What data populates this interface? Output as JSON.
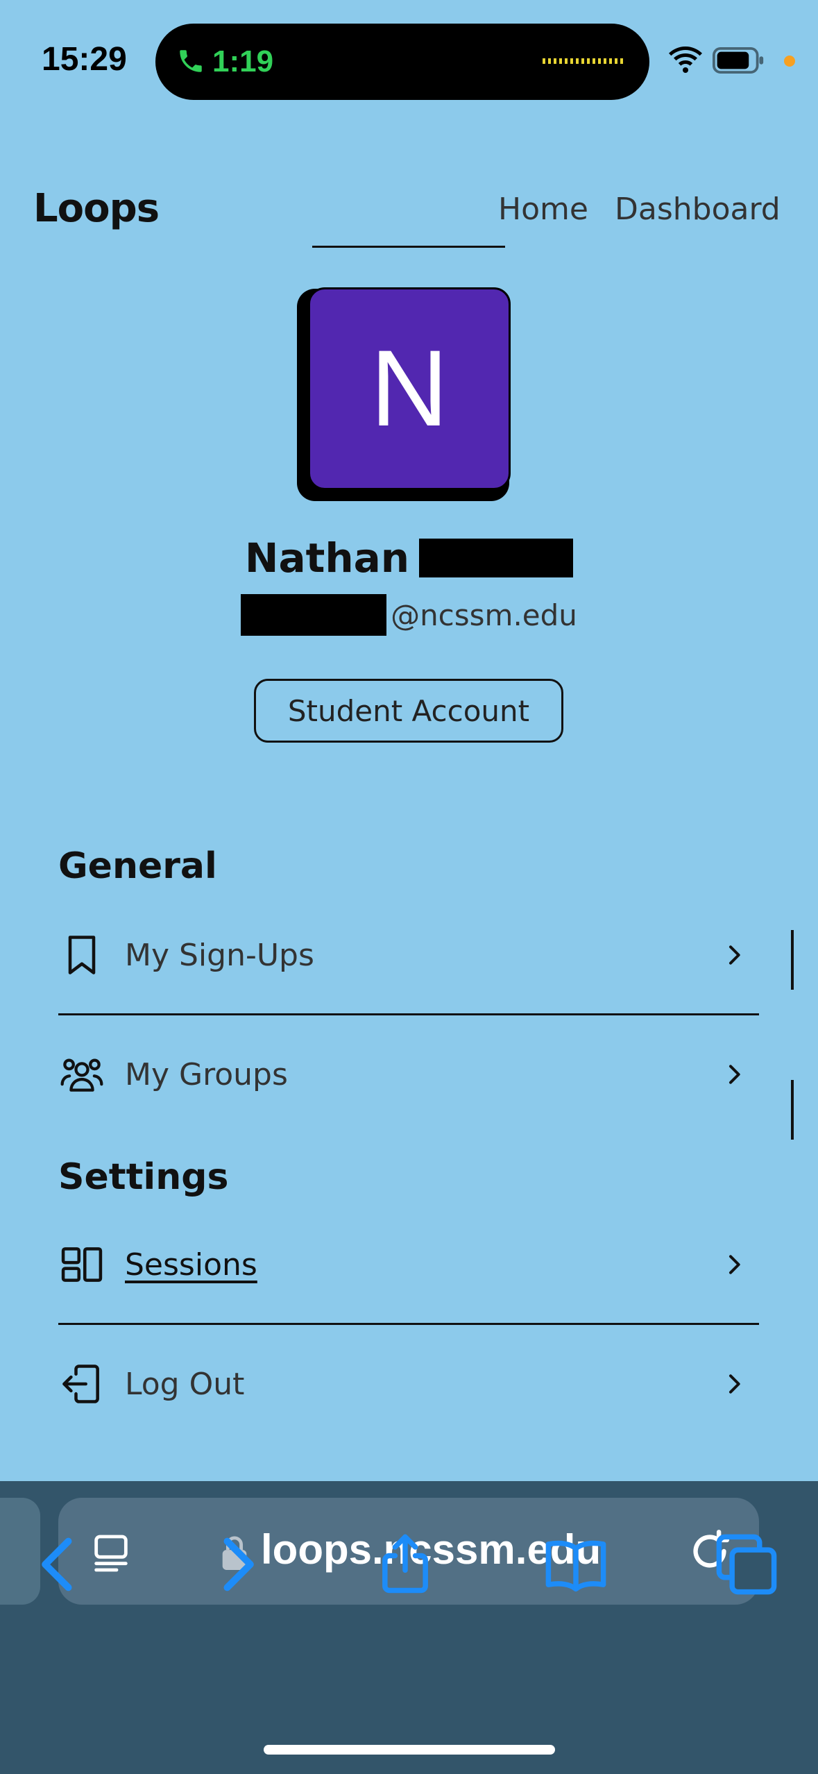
{
  "status_bar": {
    "time": "15:29",
    "call_duration": "1:19"
  },
  "header": {
    "logo": "Loops",
    "nav": {
      "home": "Home",
      "dashboard": "Dashboard"
    }
  },
  "profile": {
    "avatar_initial": "N",
    "first_name": "Nathan",
    "email_domain": "@ncssm.edu",
    "account_type": "Student Account"
  },
  "sections": {
    "general": {
      "title": "General",
      "items": [
        {
          "label": "My Sign-Ups",
          "icon": "bookmark-icon"
        },
        {
          "label": "My Groups",
          "icon": "users-icon"
        }
      ]
    },
    "settings": {
      "title": "Settings",
      "items": [
        {
          "label": "Sessions",
          "icon": "layout-icon"
        },
        {
          "label": "Log Out",
          "icon": "logout-icon"
        }
      ]
    }
  },
  "browser": {
    "url": "loops.ncssm.edu"
  },
  "colors": {
    "background": "#8ccaeb",
    "avatar": "#5227b0",
    "browser_bar": "#33556a",
    "ios_blue": "#1d8cf8",
    "call_green": "#31d158"
  }
}
